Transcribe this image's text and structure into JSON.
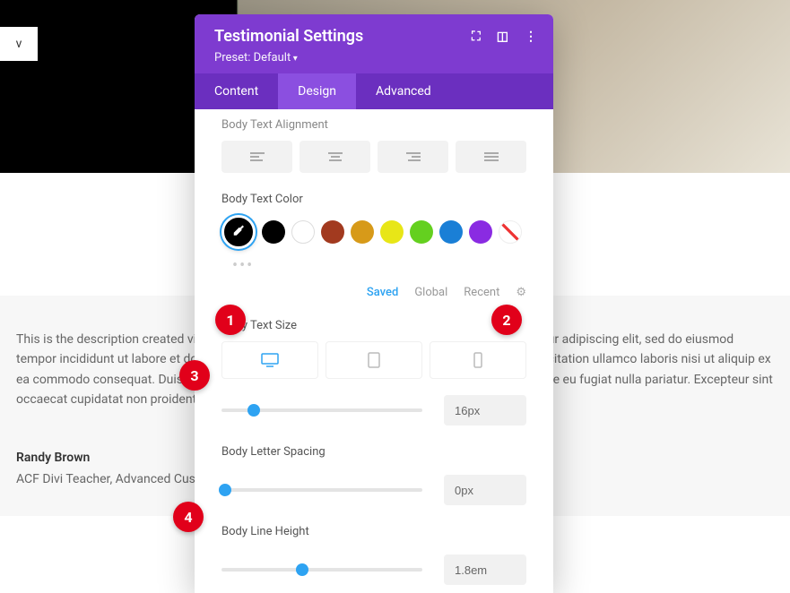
{
  "bg": {
    "left_box": "v"
  },
  "testimonial": {
    "body": "This is the description created via the ACF repeater field. Lorem ipsum dolor sit amet, consectetur adipiscing elit, sed do eiusmod tempor incididunt ut labore et dolore magna aliqua. Ut enim ad minim veniam, quis nostrud exercitation ullamco laboris nisi ut aliquip ex ea commodo consequat. Duis aute irure dolor in reprehenderit in voluptate velit esse cillum dolore eu fugiat nulla pariatur. Excepteur sint occaecat cupidatat non proident, sunt in culpa qui officia deserunt mollit anim id est laborum.",
    "name": "Randy Brown",
    "role": "ACF Divi Teacher, Advanced Custom Fields"
  },
  "modal": {
    "title": "Testimonial Settings",
    "preset": "Preset: Default",
    "tabs": {
      "content": "Content",
      "design": "Design",
      "advanced": "Advanced"
    }
  },
  "sections": {
    "alignment_label": "Body Text Alignment",
    "color_label": "Body Text Color",
    "size_label": "Body Text Size",
    "letter_label": "Body Letter Spacing",
    "line_label": "Body Line Height"
  },
  "colors": {
    "swatches": [
      "#000000",
      "#ffffff",
      "#a23a1f",
      "#d79a19",
      "#e8e617",
      "#64d01f",
      "#1a7fd6",
      "#8a2be2"
    ],
    "none_pattern": true
  },
  "palette_meta": {
    "saved": "Saved",
    "global": "Global",
    "recent": "Recent"
  },
  "sliders": {
    "size": {
      "value": "16px",
      "pos_pct": 16
    },
    "letter": {
      "value": "0px",
      "pos_pct": 2
    },
    "line": {
      "value": "1.8em",
      "pos_pct": 40
    }
  },
  "callouts": {
    "c1": "1",
    "c2": "2",
    "c3": "3",
    "c4": "4"
  }
}
